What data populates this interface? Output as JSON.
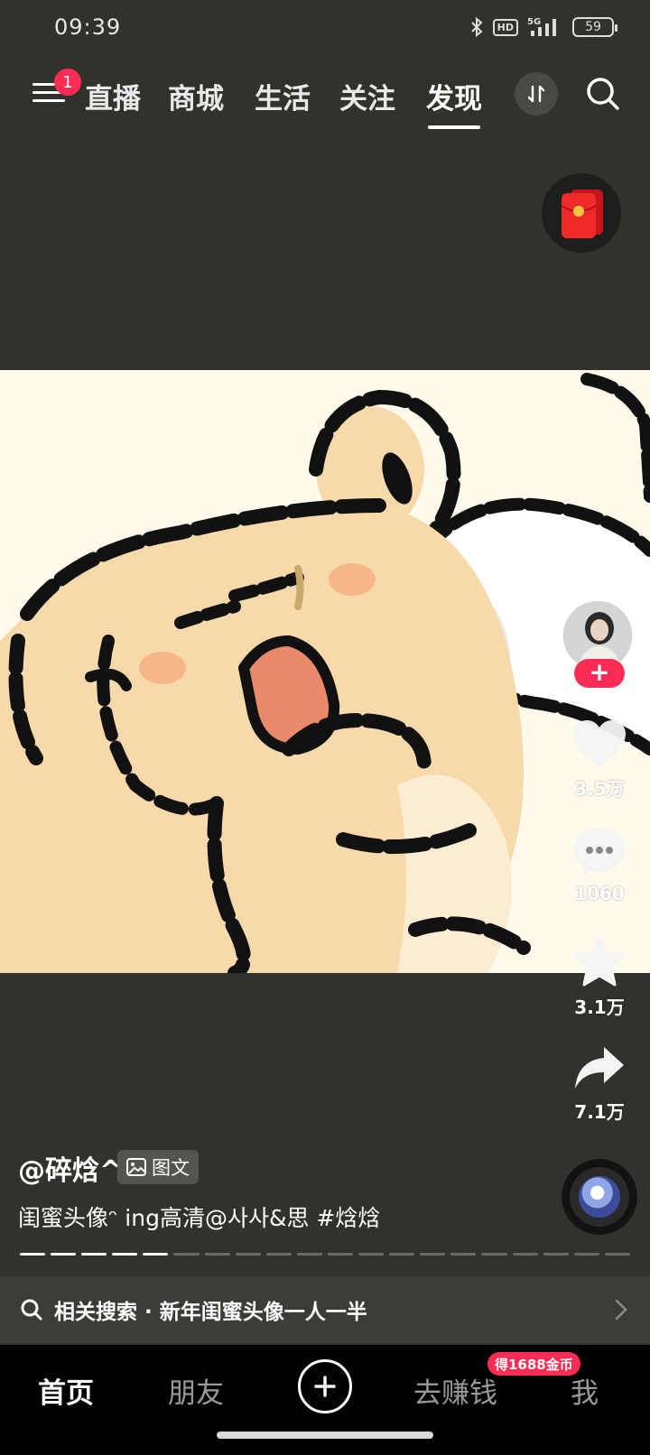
{
  "status_bar": {
    "time": "09:39",
    "network": "5G",
    "hd": "HD",
    "battery": "59"
  },
  "top_nav": {
    "menu_badge": "1",
    "tabs": [
      {
        "label": "直播",
        "active": false
      },
      {
        "label": "商城",
        "active": false
      },
      {
        "label": "生活",
        "active": false
      },
      {
        "label": "关注",
        "active": false
      },
      {
        "label": "发现",
        "active": true
      }
    ]
  },
  "actions": {
    "follow_symbol": "+",
    "likes": "3.5万",
    "comments": "1060",
    "favorites": "3.1万",
    "shares": "7.1万"
  },
  "post": {
    "author": "@碎焓^",
    "type_tag": "图文",
    "description": "闺蜜头像ᵔ ing高清@사사&思 #焓焓",
    "image_count": 20,
    "image_index": 5
  },
  "related_search": {
    "text": "相关搜索 · 新年闺蜜头像一人一半"
  },
  "bottom_nav": {
    "items": [
      {
        "label": "首页",
        "active": true
      },
      {
        "label": "朋友",
        "active": false
      },
      {
        "label": "去赚钱",
        "active": false
      },
      {
        "label": "我",
        "active": false
      }
    ],
    "coin_badge": "得1688金币"
  },
  "colors": {
    "accent": "#fe2c55",
    "background": "#32312c",
    "nav_background": "#000000"
  }
}
